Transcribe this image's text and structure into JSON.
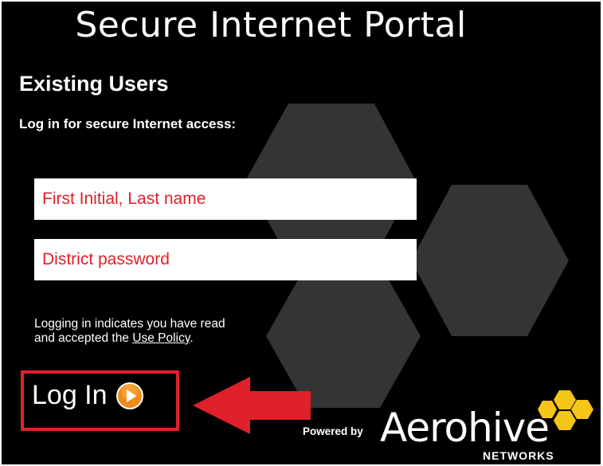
{
  "page": {
    "title": "Secure Internet Portal",
    "heading": "Existing Users",
    "subheading": "Log in for secure Internet access:"
  },
  "form": {
    "username_placeholder": "First Initial, Last name",
    "username_value": "",
    "password_placeholder": "District password",
    "password_value": "",
    "policy_text_line1": "Logging in indicates you have read",
    "policy_text_line2_pre": "and accepted the",
    "policy_link": "Use Policy",
    "policy_text_line2_post": ".",
    "login_label": "Log In"
  },
  "footer": {
    "powered_by": "Powered by",
    "brand": "Aerohive",
    "brand_sub": "NETWORKS"
  },
  "icons": {
    "login": "play-circle-icon",
    "annotation": "red-arrow-left-icon",
    "logo": "aerohive-hex-logo-icon"
  },
  "colors": {
    "background": "#000000",
    "placeholder": "#e0202a",
    "highlight": "#e0202a",
    "hex_pattern": "#333333",
    "logo": "#f5c518",
    "play_button": "#f08a1c"
  }
}
